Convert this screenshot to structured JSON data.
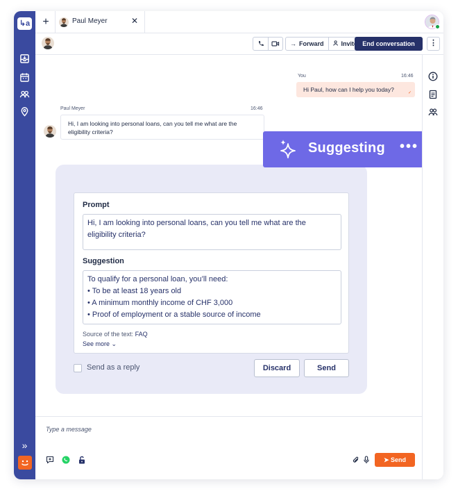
{
  "app": {
    "brand_color": "#3a4a9f",
    "accent_color": "#f26522",
    "logo_text": "↳a"
  },
  "tabs": {
    "new_tab_icon": "plus-icon",
    "active": {
      "name": "Paul Meyer",
      "close_icon": "close-icon"
    }
  },
  "toolbar": {
    "call_icon": "phone-icon",
    "video_icon": "video-icon",
    "forward_label": "Forward",
    "invite_label": "Invite",
    "end_label": "End conversation",
    "more_icon": "more-vertical-icon"
  },
  "sidebar_left": {
    "icons": [
      "inbox-icon",
      "calendar-icon",
      "users-icon",
      "location-icon"
    ],
    "expand_icon": "double-chevron-right-icon"
  },
  "sidebar_right": {
    "icons": [
      "info-icon",
      "notes-icon",
      "users-icon"
    ]
  },
  "messages": [
    {
      "sender": "You",
      "time": "16:46",
      "text": "Hi Paul, how can I help you today?"
    },
    {
      "sender": "Paul Meyer",
      "time": "16:46",
      "text": "Hi, I am looking into personal loans, can you tell me what are the eligibility criteria?"
    }
  ],
  "suggestion_panel": {
    "badge_label": "Suggesting",
    "badge_dots": "•••",
    "prompt_label": "Prompt",
    "prompt_text": "Hi, I am looking into personal loans, can you tell me what are the eligibility criteria?",
    "suggestion_label": "Suggestion",
    "suggestion_lines": [
      "To qualify for a personal loan, you’ll need:",
      "• To be at least 18 years old",
      "• A minimum monthly income of CHF 3,000",
      "• Proof of employment or a stable source of income"
    ],
    "source_label": "Source of the text:",
    "source_value": "FAQ",
    "see_more_label": "See more ⌄",
    "send_as_reply_label": "Send as a reply",
    "discard_label": "Discard",
    "send_label": "Send"
  },
  "composer": {
    "placeholder": "Type a message",
    "send_label": "Send",
    "send_arrow": "➤"
  }
}
